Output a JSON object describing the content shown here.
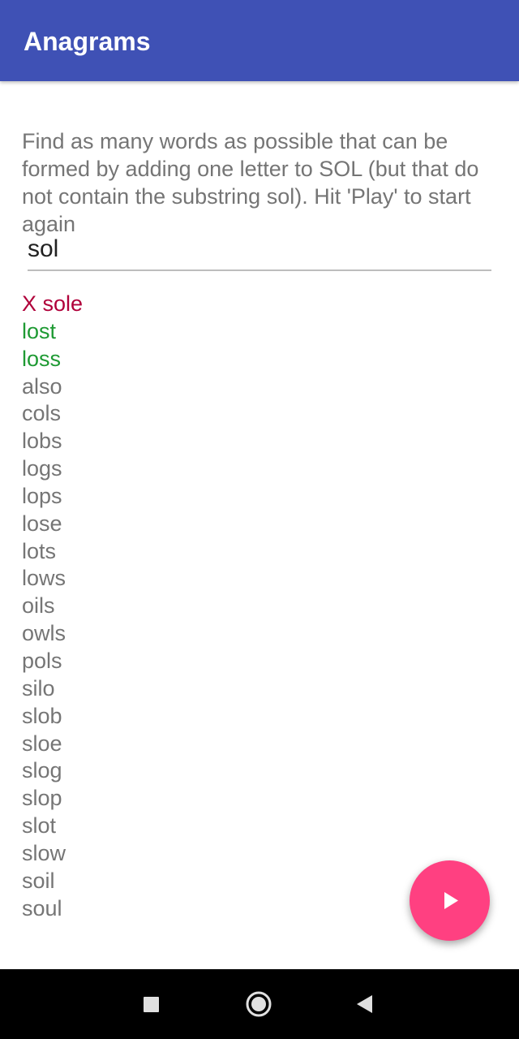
{
  "app_bar": {
    "title": "Anagrams"
  },
  "instructions": "Find as many words as possible that can be formed by adding one letter to SOL (but that do not contain the substring sol). Hit 'Play' to start again",
  "input": {
    "value": "sol"
  },
  "words": [
    {
      "text": "X sole",
      "status": "wrong"
    },
    {
      "text": "lost",
      "status": "right"
    },
    {
      "text": "loss",
      "status": "right"
    },
    {
      "text": "also",
      "status": "unfound"
    },
    {
      "text": "cols",
      "status": "unfound"
    },
    {
      "text": "lobs",
      "status": "unfound"
    },
    {
      "text": "logs",
      "status": "unfound"
    },
    {
      "text": "lops",
      "status": "unfound"
    },
    {
      "text": "lose",
      "status": "unfound"
    },
    {
      "text": "lots",
      "status": "unfound"
    },
    {
      "text": "lows",
      "status": "unfound"
    },
    {
      "text": "oils",
      "status": "unfound"
    },
    {
      "text": "owls",
      "status": "unfound"
    },
    {
      "text": "pols",
      "status": "unfound"
    },
    {
      "text": "silo",
      "status": "unfound"
    },
    {
      "text": "slob",
      "status": "unfound"
    },
    {
      "text": "sloe",
      "status": "unfound"
    },
    {
      "text": "slog",
      "status": "unfound"
    },
    {
      "text": "slop",
      "status": "unfound"
    },
    {
      "text": "slot",
      "status": "unfound"
    },
    {
      "text": "slow",
      "status": "unfound"
    },
    {
      "text": "soil",
      "status": "unfound"
    },
    {
      "text": "soul",
      "status": "unfound"
    }
  ],
  "fab": {
    "icon": "play-icon"
  },
  "nav_bar": {
    "icons": [
      "square-icon",
      "circle-home-icon",
      "triangle-back-icon"
    ]
  },
  "colors": {
    "app_bar": "#3F51B5",
    "wrong_word": "#B0003A",
    "right_word": "#1E9A33",
    "unfound_word": "#757575",
    "fab": "#FF4081"
  }
}
